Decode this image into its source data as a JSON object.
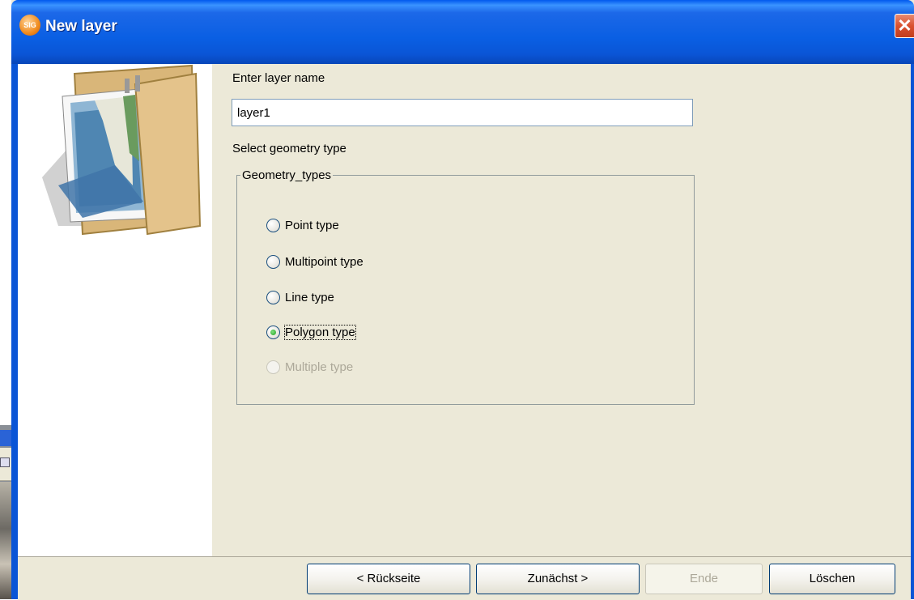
{
  "dialog": {
    "title": "New layer",
    "app_icon_text": "SIG",
    "close_glyph": "✕"
  },
  "form": {
    "name_label": "Enter layer name",
    "name_value": "layer1",
    "geometry_label": "Select geometry type",
    "group_title": "Geometry_types",
    "options": [
      {
        "label": "Point type",
        "checked": false,
        "enabled": true
      },
      {
        "label": "Multipoint type",
        "checked": false,
        "enabled": true
      },
      {
        "label": "Line type",
        "checked": false,
        "enabled": true
      },
      {
        "label": "Polygon type",
        "checked": true,
        "enabled": true,
        "focused": true
      },
      {
        "label": "Multiple type",
        "checked": false,
        "enabled": false
      }
    ]
  },
  "buttons": {
    "back": "< Rückseite",
    "next": "Zunächst >",
    "finish": "Ende",
    "cancel": "Löschen"
  },
  "icons": {
    "dialog_icon": "app-logo-icon",
    "wizard_image": "folder-with-maps-icon"
  },
  "colors": {
    "titlebar": "#0a5fe3",
    "dialog_bg": "#ece9d8",
    "close_button": "#d9512f",
    "radio_checked": "#21a121"
  }
}
